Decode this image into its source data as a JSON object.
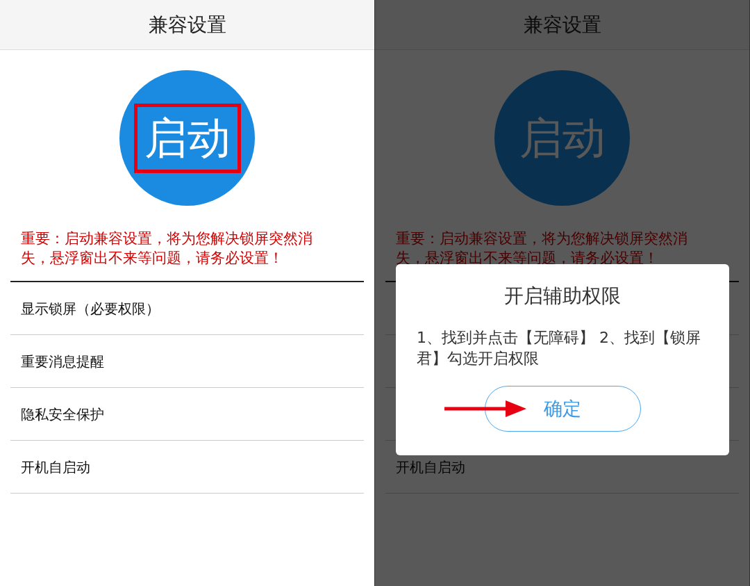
{
  "panels": [
    {
      "title": "兼容设置",
      "start_button": {
        "label": "启动",
        "highlighted": true
      },
      "notice": "重要：启动兼容设置，将为您解决锁屏突然消失，悬浮窗出不来等问题，请务必设置！",
      "dimmed": false,
      "items": [
        {
          "label": "显示锁屏（必要权限）"
        },
        {
          "label": "重要消息提醒"
        },
        {
          "label": "隐私安全保护"
        },
        {
          "label": "开机自启动"
        }
      ]
    },
    {
      "title": "兼容设置",
      "start_button": {
        "label": "启动",
        "highlighted": false
      },
      "notice": "重要：启动兼容设置，将为您解决锁屏突然消失，悬浮窗出不来等问题，请务必设置！",
      "dimmed": true,
      "items": [
        {
          "label": "开机自启动"
        }
      ],
      "dialog": {
        "title": "开启辅助权限",
        "message": "1、找到并点击【无障碍】 2、找到【锁屏君】勾选开启权限",
        "button": "确定",
        "arrow": true
      }
    }
  ]
}
